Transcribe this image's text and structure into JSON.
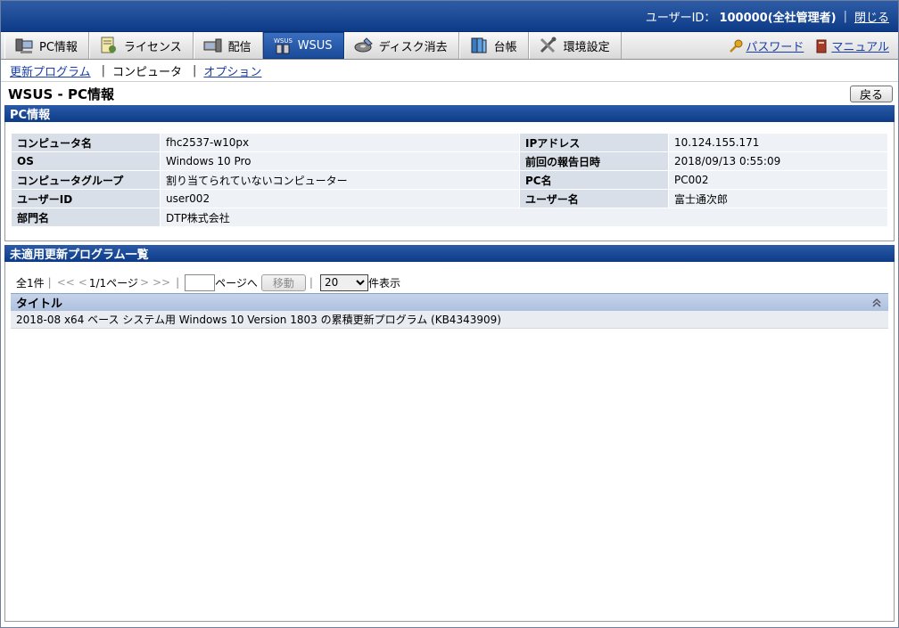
{
  "header": {
    "user_label": "ユーザーID：",
    "user_value": "100000(全社管理者)",
    "separator": "|",
    "close_label": "閉じる"
  },
  "menu": {
    "items": [
      {
        "label": "PC情報",
        "icon": "pc-icon"
      },
      {
        "label": "ライセンス",
        "icon": "license-icon"
      },
      {
        "label": "配信",
        "icon": "delivery-icon"
      },
      {
        "label": "WSUS",
        "icon": "wsus-icon",
        "active": true
      },
      {
        "label": "ディスク消去",
        "icon": "disk-erase-icon"
      },
      {
        "label": "台帳",
        "icon": "ledger-icon"
      },
      {
        "label": "環境設定",
        "icon": "settings-icon"
      }
    ],
    "password_label": "パスワード",
    "manual_label": "マニュアル"
  },
  "subnav": {
    "update_programs": "更新プログラム",
    "computer": "コンピュータ",
    "options": "オプション",
    "separator": "|"
  },
  "page": {
    "title": "WSUS - PC情報",
    "back_label": "戻る"
  },
  "pc_info": {
    "header": "PC情報",
    "rows": [
      {
        "k1": "コンピュータ名",
        "v1": "fhc2537-w10px",
        "k2": "IPアドレス",
        "v2": "10.124.155.171"
      },
      {
        "k1": "OS",
        "v1": "Windows 10 Pro",
        "k2": "前回の報告日時",
        "v2": "2018/09/13 0:55:09"
      },
      {
        "k1": "コンピュータグループ",
        "v1": "割り当てられていないコンピューター",
        "k2": "PC名",
        "v2": "PC002"
      },
      {
        "k1": "ユーザーID",
        "v1": "user002",
        "k2": "ユーザー名",
        "v2": "富士通次郎"
      }
    ],
    "dept_label": "部門名",
    "dept_value": "DTP株式会社"
  },
  "updates": {
    "header": "未適用更新プログラム一覧",
    "total": "全1件",
    "first": "<<",
    "prev": "<",
    "page_status": "1/1ページ",
    "next": ">",
    "last": ">>",
    "page_input": "",
    "goto_suffix": "ページへ",
    "go_label": "移動",
    "per_page_selected": "20",
    "per_page_suffix": "件表示",
    "column_title": "タイトル",
    "items": [
      "2018-08 x64 ベース システム用 Windows 10 Version 1803 の累積更新プログラム (KB4343909)"
    ]
  },
  "colors": {
    "header_blue": "#0d3b87",
    "link_blue": "#1a3fa8",
    "label_bg": "#d9dfe8",
    "value_bg": "#eef1f5"
  }
}
